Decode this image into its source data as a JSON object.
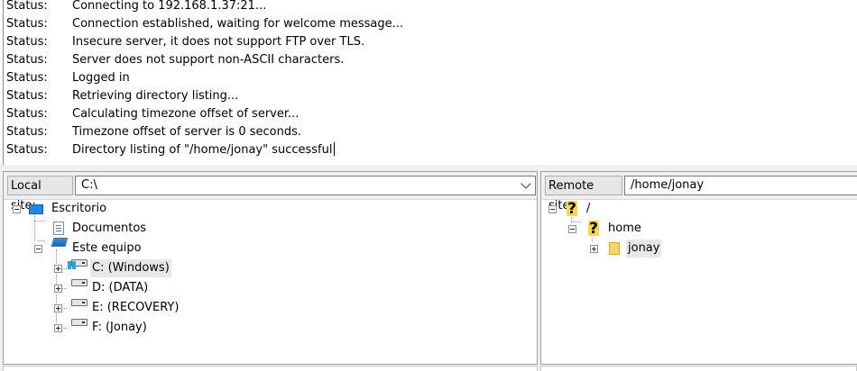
{
  "log": {
    "messages": [
      {
        "label": "Status:",
        "text": "Connecting to 192.168.1.37:21..."
      },
      {
        "label": "Status:",
        "text": "Connection established, waiting for welcome message..."
      },
      {
        "label": "Status:",
        "text": "Insecure server, it does not support FTP over TLS."
      },
      {
        "label": "Status:",
        "text": "Server does not support non-ASCII characters."
      },
      {
        "label": "Status:",
        "text": "Logged in"
      },
      {
        "label": "Status:",
        "text": "Retrieving directory listing..."
      },
      {
        "label": "Status:",
        "text": "Calculating timezone offset of server..."
      },
      {
        "label": "Status:",
        "text": "Timezone offset of server is 0 seconds."
      },
      {
        "label": "Status:",
        "text": "Directory listing of \"/home/jonay\" successful"
      }
    ]
  },
  "local": {
    "label": "Local site:",
    "path": "C:\\",
    "tree": {
      "root": "Escritorio",
      "documents": "Documentos",
      "computer": "Este equipo",
      "drives": [
        "C: (Windows)",
        "D: (DATA)",
        "E: (RECOVERY)",
        "F: (Jonay)"
      ]
    }
  },
  "remote": {
    "label": "Remote site:",
    "path": "/home/jonay",
    "tree": {
      "root": "/",
      "home": "home",
      "user": "jonay"
    }
  },
  "icons": {
    "root": "desktop-icon",
    "documents": "document-icon",
    "computer": "computer-icon",
    "drive": "drive-icon",
    "unknown": "question-icon",
    "folder": "folder-icon"
  },
  "colors": {
    "desktop": "#1e88e5",
    "folder": "#f8d26a",
    "question": "#ffd54f"
  }
}
